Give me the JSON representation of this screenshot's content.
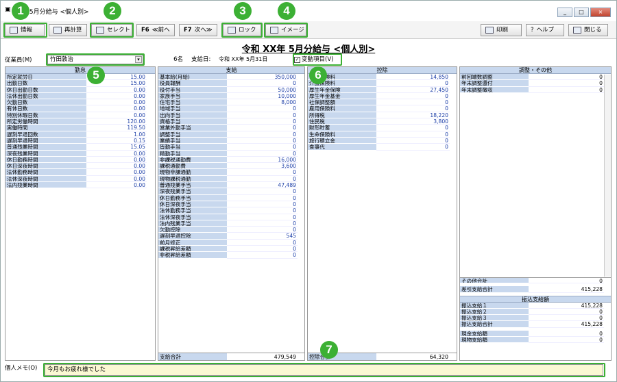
{
  "window": {
    "title": "年 5月分給与 <個人別>",
    "buttons": [
      "_",
      "□",
      "×"
    ]
  },
  "toolbar": {
    "info": "情報",
    "recalc": "再計算",
    "select": "セレクト",
    "prev_key": "F6",
    "prev": "≪前へ",
    "next_key": "F7",
    "next": "次へ≫",
    "lock": "ロック",
    "image": "イメージ",
    "print": "印刷",
    "help": "ヘルプ",
    "close": "閉じる"
  },
  "badges": [
    "1",
    "2",
    "3",
    "4",
    "5",
    "6",
    "7"
  ],
  "title": "令和  XX年 5月分給与 <個人別>",
  "employee": {
    "label": "従業員(M)",
    "value": "竹田敦治",
    "count": "6名",
    "pay_date_label": "支給日:",
    "pay_date": "令和 XX年 5月31日",
    "checkbox_label": "変動項目(V)",
    "checked": "✓"
  },
  "attendance": {
    "header": "勤怠",
    "items": [
      [
        "所定就労日",
        "15.00"
      ],
      [
        "出勤日数",
        "15.00"
      ],
      [
        "休日出勤日数",
        "0.00"
      ],
      [
        "法休出勤日数",
        "0.00"
      ],
      [
        "欠勤日数",
        "0.00"
      ],
      [
        "有休日数",
        "0.00"
      ],
      [
        "特別休暇日数",
        "0.00"
      ],
      [
        "所定労働時間",
        "120.00"
      ],
      [
        "実働時間",
        "119.50"
      ],
      [
        "遅刻早退回数",
        "1.00"
      ],
      [
        "遅刻早退時間",
        "0.15"
      ],
      [
        "普通残業時間",
        "15.05"
      ],
      [
        "深夜残業時間",
        "0.00"
      ],
      [
        "休日勤務時間",
        "0.00"
      ],
      [
        "休日深夜時間",
        "0.00"
      ],
      [
        "法休勤務時間",
        "0.00"
      ],
      [
        "法休深夜時間",
        "0.00"
      ],
      [
        "法内残業時間",
        "0.00"
      ]
    ]
  },
  "payment": {
    "header": "支給",
    "items": [
      [
        "基本給(月給)",
        "350,000"
      ],
      [
        "役員報酬",
        "0"
      ],
      [
        "役付手当",
        "50,000"
      ],
      [
        "家族手当",
        "10,000"
      ],
      [
        "住宅手当",
        "8,000"
      ],
      [
        "地域手当",
        "0"
      ],
      [
        "出向手当",
        "0"
      ],
      [
        "資格手当",
        "0"
      ],
      [
        "営業外勤手当",
        "0"
      ],
      [
        "調整手当",
        "0"
      ],
      [
        "業績手当",
        "0"
      ],
      [
        "皆勤手当",
        "0"
      ],
      [
        "精勤手当",
        "0"
      ],
      [
        "非課税通勤費",
        "16,000"
      ],
      [
        "課税通勤費",
        "3,600"
      ],
      [
        "現物非課通勤",
        "0"
      ],
      [
        "現物課税通勤",
        "0"
      ],
      [
        "普通残業手当",
        "47,489"
      ],
      [
        "深夜残業手当",
        "0"
      ],
      [
        "休日勤務手当",
        "0"
      ],
      [
        "休日深夜手当",
        "0"
      ],
      [
        "法休勤務手当",
        "0"
      ],
      [
        "法休深夜手当",
        "0"
      ],
      [
        "法内残業手当",
        "0"
      ],
      [
        "欠勤控除",
        "0"
      ],
      [
        "遅刻早退控除",
        "545"
      ],
      [
        "前月修正",
        "0"
      ],
      [
        "課税昇給差額",
        "0"
      ],
      [
        "非税昇給差額",
        "0"
      ]
    ],
    "total_label": "支給合計",
    "total": "479,549"
  },
  "deduction": {
    "header": "控除",
    "items": [
      [
        "健康保険料",
        "14,850"
      ],
      [
        "介護保険料",
        "0"
      ],
      [
        "厚生年金保険",
        "27,450"
      ],
      [
        "厚生年金基金",
        "0"
      ],
      [
        "社保調整額",
        "0"
      ],
      [
        "雇用保険料",
        "0"
      ],
      [
        "所得税",
        "18,220"
      ],
      [
        "住民税",
        "3,800"
      ],
      [
        "財形貯蓄",
        "0"
      ],
      [
        "生命保険料",
        "0"
      ],
      [
        "旅行積立金",
        "0"
      ],
      [
        "食事代",
        "0"
      ]
    ],
    "total_label": "控除合計",
    "total": "64,320"
  },
  "other": {
    "header": "調整・その他",
    "items": [
      [
        "前回端数調整",
        "0"
      ],
      [
        "年末調整還付",
        "0"
      ],
      [
        "年末調整徴収",
        "0"
      ]
    ],
    "subtotal_label": "その他合計",
    "subtotal": "0",
    "net_label": "差引支給合計",
    "net": "415,228",
    "transfer_header": "振込支給額",
    "transfers": [
      [
        "振込支給１",
        "415,228"
      ],
      [
        "振込支給２",
        "0"
      ],
      [
        "振込支給３",
        "0"
      ],
      [
        "振込支給合計",
        "415,228"
      ]
    ],
    "cash_label": "現金支給額",
    "cash": "0",
    "goods_label": "現物支給額",
    "goods": "0"
  },
  "memo": {
    "label": "個人メモ(O)",
    "value": "今月もお疲れ様でした"
  },
  "colors": {
    "highlight": "#3cb034",
    "label_bg": "#c8d8ee",
    "value_blue": "#1c3ea8",
    "memo_bg": "#fbf8d3"
  }
}
